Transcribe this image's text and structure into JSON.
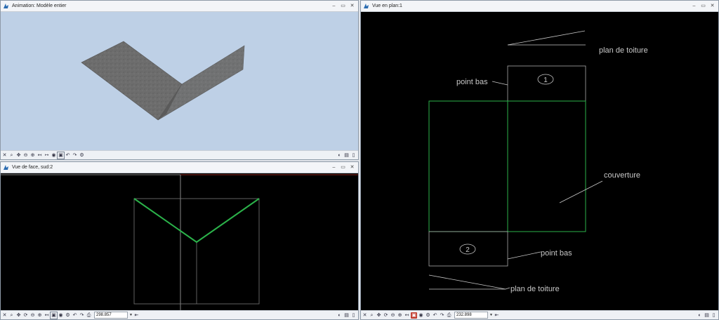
{
  "windows": {
    "animation": {
      "title": "Animation: Modèle entier"
    },
    "front": {
      "title": "Vue de face, sud:2",
      "scale": "298.857"
    },
    "plan": {
      "title": "Vue en plan:1",
      "scale": "232.898"
    }
  },
  "plan_labels": {
    "roof_plane_top": "plan de toiture",
    "roof_plane_bottom": "plan de toiture",
    "low_point_top": "point bas",
    "low_point_bottom": "point bas",
    "covering": "couverture",
    "marker_1": "1",
    "marker_2": "2"
  },
  "window_controls": {
    "minimize": "–",
    "restore": "▭",
    "close": "✕"
  },
  "colors": {
    "model_bg": "#bed0e6",
    "drawing_bg": "#000000",
    "green": "#2bb24a",
    "lines": "#c8c8c8"
  }
}
